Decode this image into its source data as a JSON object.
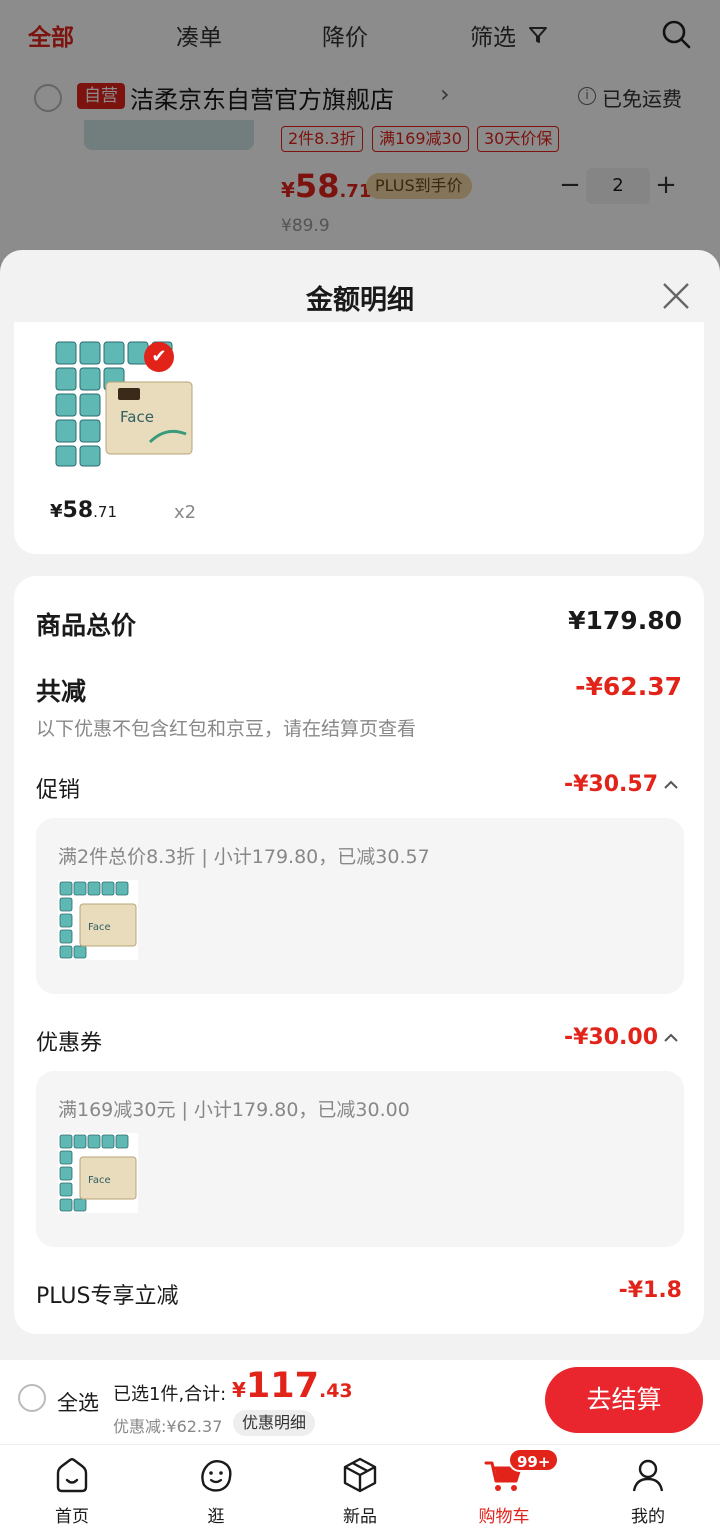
{
  "tabs": [
    "全部",
    "凑单",
    "降价",
    "筛选"
  ],
  "shop": {
    "badge": "自营",
    "name": "洁柔京东自营官方旗舰店",
    "arrow": "›",
    "shipping": "已免运费",
    "info_icon": "i"
  },
  "bg_item": {
    "tags": [
      "2件8.3折",
      "满169减30",
      "30天价保"
    ],
    "price_yen": "¥",
    "price_int": "58",
    "price_dec": ".71",
    "plus_chip": "PLUS到手价",
    "orig_price": "¥89.9",
    "stepper": {
      "minus": "−",
      "value": "2",
      "plus": "+"
    }
  },
  "sheet": {
    "title": "金额明细",
    "product": {
      "check": "✔",
      "price_yen": "¥",
      "price_int": "58",
      "price_dec": ".71",
      "qty": "x2"
    },
    "total_label": "商品总价",
    "total_value": "¥179.80",
    "reduce_label": "共减",
    "reduce_value": "-¥62.37",
    "reduce_note": "以下优惠不包含红包和京豆，请在结算页查看",
    "promo": {
      "label": "促销",
      "value": "-¥30.57",
      "detail": "满2件总价8.3折 | 小计179.80，已减30.57"
    },
    "coupon": {
      "label": "优惠券",
      "value": "-¥30.00",
      "detail": "满169减30元 | 小计179.80，已减30.00"
    },
    "plus": {
      "label": "PLUS专享立减",
      "value": "-¥1.8"
    }
  },
  "checkout": {
    "select_all": "全选",
    "selected": "已选1件,合计:",
    "total_yen": "¥",
    "total_int": "117",
    "total_dec": ".43",
    "discount": "优惠减:¥62.37",
    "detail_chip": "优惠明细",
    "button": "去结算"
  },
  "nav": {
    "items": [
      "首页",
      "逛",
      "新品",
      "购物车",
      "我的"
    ],
    "cart_badge": "99+"
  },
  "icons": [
    "filter-icon",
    "search-icon",
    "close-icon",
    "home-icon",
    "face-icon",
    "cube-icon",
    "cart-icon",
    "user-icon"
  ],
  "colors": {
    "accent": "#e2231a",
    "plus_gold": "#f0d3a3"
  }
}
